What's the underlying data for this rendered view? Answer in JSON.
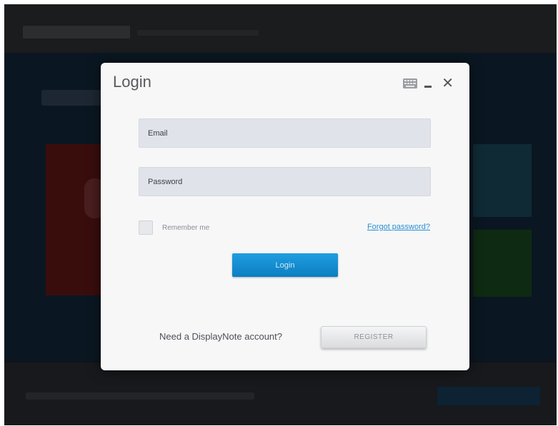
{
  "dialog": {
    "title": "Login",
    "icons": {
      "keyboard": "keyboard-icon",
      "minimize": "minimize-icon",
      "close": "close-icon",
      "close_glyph": "✕"
    }
  },
  "form": {
    "email_placeholder": "Email",
    "email_value": "",
    "password_placeholder": "Password",
    "password_value": "",
    "remember_label": "Remember me",
    "remember_checked": false,
    "forgot_label": "Forgot password?",
    "login_label": "Login"
  },
  "footer": {
    "prompt": "Need a DisplayNote account?",
    "register_label": "REGISTER"
  },
  "colors": {
    "accent": "#1a93d6",
    "link": "#2a8fd1",
    "dialog_bg": "#f7f7f8",
    "field_bg": "#e0e3ea",
    "overlay_bg": "#111316"
  }
}
